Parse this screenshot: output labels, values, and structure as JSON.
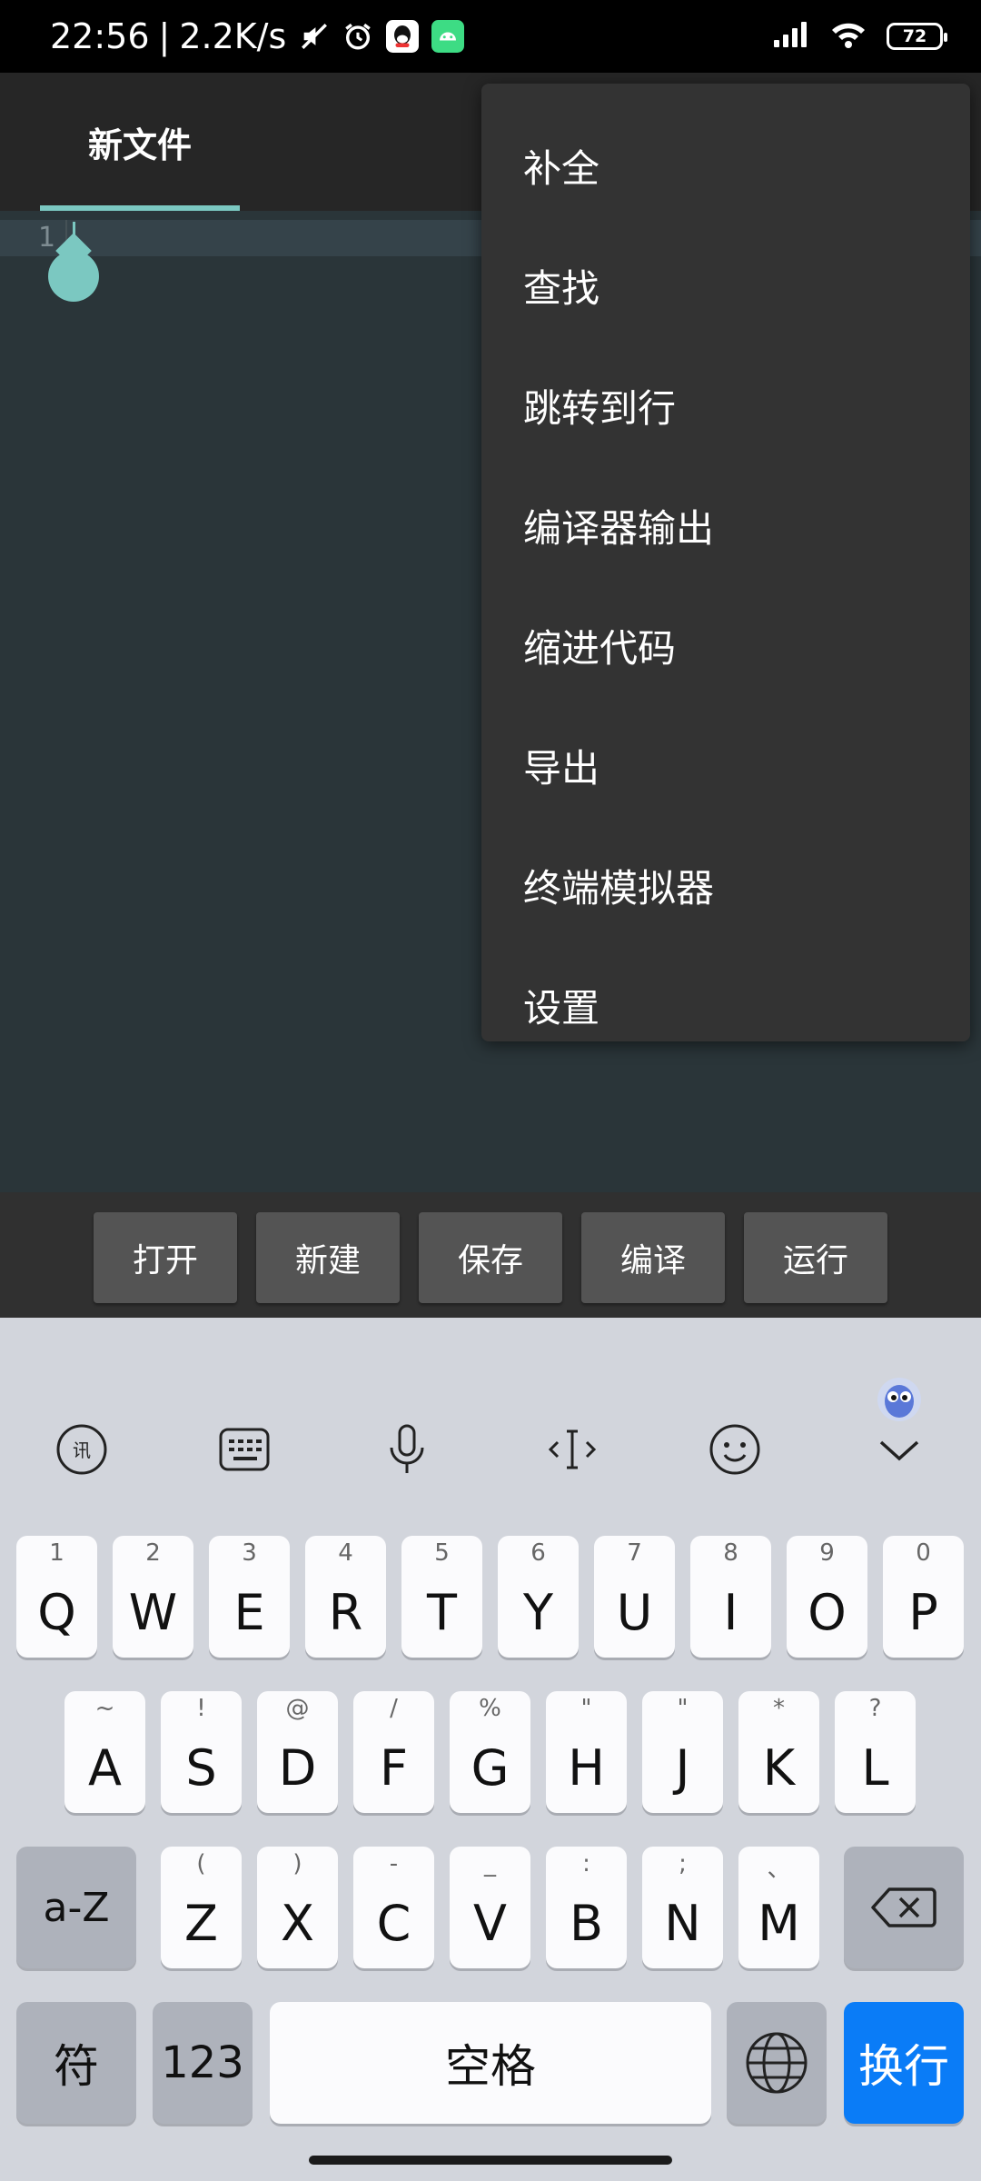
{
  "status_bar": {
    "time": "22:56",
    "separator": "|",
    "net_speed": "2.2K/s",
    "battery": "72"
  },
  "app": {
    "tab_title": "新文件"
  },
  "editor": {
    "line_number": "1"
  },
  "menu": {
    "items": [
      "补全",
      "查找",
      "跳转到行",
      "编译器输出",
      "缩进代码",
      "导出",
      "终端模拟器",
      "设置"
    ]
  },
  "toolbar": {
    "buttons": [
      "打开",
      "新建",
      "保存",
      "编译",
      "运行"
    ]
  },
  "keyboard": {
    "row1": [
      {
        "key": "Q",
        "hint": "1"
      },
      {
        "key": "W",
        "hint": "2"
      },
      {
        "key": "E",
        "hint": "3"
      },
      {
        "key": "R",
        "hint": "4"
      },
      {
        "key": "T",
        "hint": "5"
      },
      {
        "key": "Y",
        "hint": "6"
      },
      {
        "key": "U",
        "hint": "7"
      },
      {
        "key": "I",
        "hint": "8"
      },
      {
        "key": "O",
        "hint": "9"
      },
      {
        "key": "P",
        "hint": "0"
      }
    ],
    "row2": [
      {
        "key": "A",
        "hint": "~"
      },
      {
        "key": "S",
        "hint": "!"
      },
      {
        "key": "D",
        "hint": "@"
      },
      {
        "key": "F",
        "hint": "/"
      },
      {
        "key": "G",
        "hint": "%"
      },
      {
        "key": "H",
        "hint": "\""
      },
      {
        "key": "J",
        "hint": "\""
      },
      {
        "key": "K",
        "hint": "*"
      },
      {
        "key": "L",
        "hint": "?"
      }
    ],
    "row3": [
      {
        "key": "Z",
        "hint": "("
      },
      {
        "key": "X",
        "hint": ")"
      },
      {
        "key": "C",
        "hint": "-"
      },
      {
        "key": "V",
        "hint": "_"
      },
      {
        "key": "B",
        "hint": ":"
      },
      {
        "key": "N",
        "hint": ";"
      },
      {
        "key": "M",
        "hint": "、"
      }
    ],
    "case_key": "a-Z",
    "symbols_key": "符",
    "numbers_key": "123",
    "space_key": "空格",
    "enter_key": "换行"
  },
  "colors": {
    "accent": "#7bc8c1",
    "enter_key": "#0a7cf7",
    "menu_bg": "#333333",
    "editor_bg": "#2a3539"
  }
}
